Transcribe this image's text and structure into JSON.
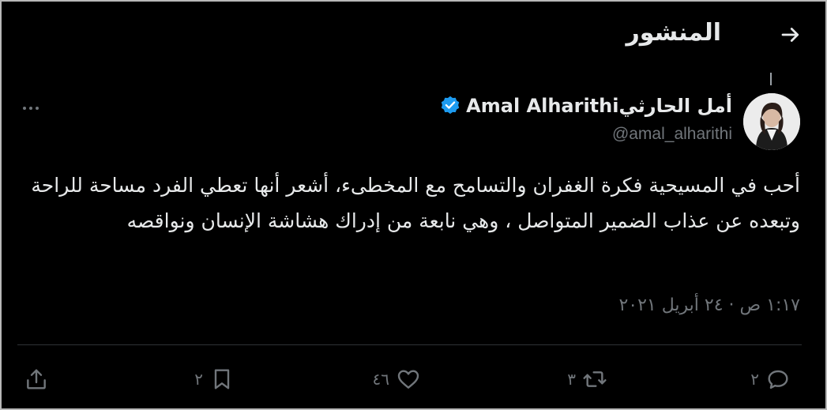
{
  "header": {
    "title": "المنشور",
    "back_icon": "arrow-right-icon"
  },
  "author": {
    "name": "أمل الحارثيAmal Alharithi",
    "handle": "@amal_alharithi",
    "verified": true,
    "verified_color": "#1d9bf0"
  },
  "post": {
    "text": "أحب في المسيحية فكرة الغفران والتسامح مع المخطىء، أشعر أنها تعطي الفرد مساحة للراحة وتبعده عن عذاب الضمير المتواصل ، وهي نابعة من إدراك هشاشة الإنسان ونواقصه",
    "timestamp": "١:١٧ ص · ٢٤ أبريل ٢٠٢١"
  },
  "actions": {
    "replies": "٢",
    "reposts": "٣",
    "likes": "٤٦",
    "bookmarks": "٢"
  },
  "colors": {
    "background": "#000000",
    "text": "#e7e9ea",
    "muted": "#71767b",
    "divider": "#2f3336"
  }
}
